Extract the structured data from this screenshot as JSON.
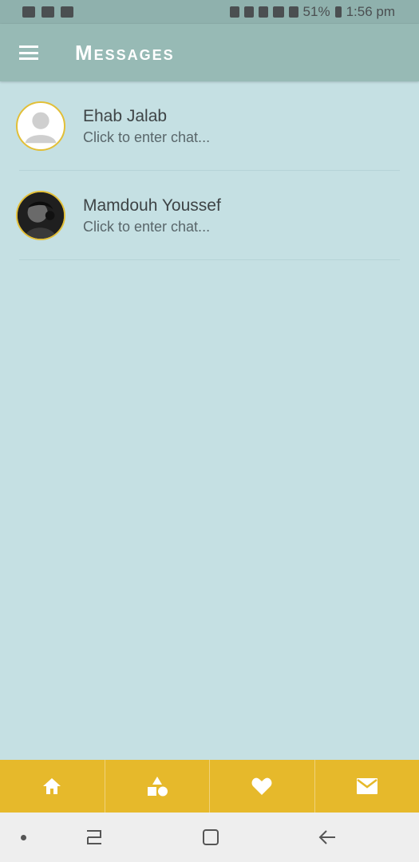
{
  "status_bar": {
    "battery": "51%",
    "time": "1:56 pm"
  },
  "app_bar": {
    "title": "Messages",
    "menu_icon": "hamburger-menu-icon"
  },
  "chats": [
    {
      "name": "Ehab Jalab",
      "subtitle": "Click to enter chat...",
      "avatar": "default-avatar"
    },
    {
      "name": "Mamdouh Youssef",
      "subtitle": "Click to enter chat...",
      "avatar": "photo-avatar"
    }
  ],
  "bottom_nav": {
    "items": [
      "home-icon",
      "shapes-icon",
      "heart-icon",
      "mail-icon"
    ]
  },
  "colors": {
    "app_bar": "#97bab5",
    "background": "#c5e0e3",
    "accent": "#e6b92b"
  }
}
